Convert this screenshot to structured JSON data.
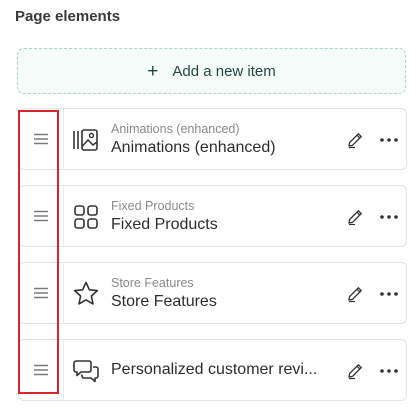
{
  "section": {
    "title": "Page elements"
  },
  "add_button": {
    "label": "Add a new item"
  },
  "items": [
    {
      "subtitle": "Animations (enhanced)",
      "title": "Animations (enhanced)",
      "icon": "animations-icon"
    },
    {
      "subtitle": "Fixed Products",
      "title": "Fixed Products",
      "icon": "grid-icon"
    },
    {
      "subtitle": "Store Features",
      "title": "Store Features",
      "icon": "star-icon"
    },
    {
      "subtitle": "",
      "title": "Personalized customer revi...",
      "icon": "chat-bubbles-icon"
    }
  ],
  "colors": {
    "accent_border": "#a9d6cd",
    "highlight": "#d7262b"
  }
}
